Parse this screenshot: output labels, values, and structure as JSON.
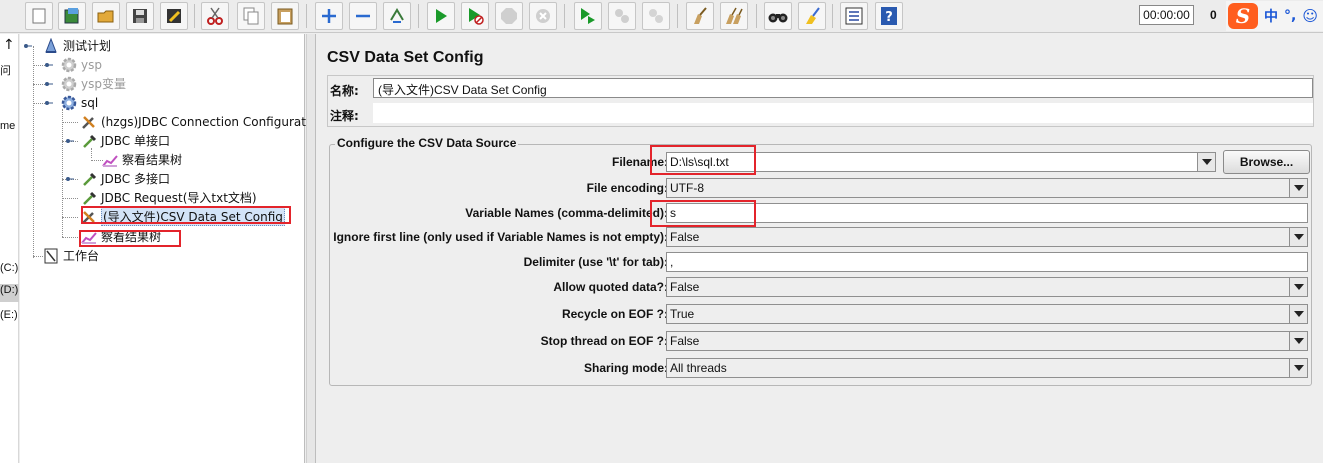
{
  "toolbar": {
    "buttons": [
      "new-icon",
      "templates-icon",
      "open-icon",
      "save-icon",
      "save-as-icon",
      "cut-icon",
      "copy-icon",
      "paste-icon",
      "expand-icon",
      "collapse-icon",
      "toggle-icon",
      "start-icon",
      "start-no-timers-icon",
      "stop-icon",
      "shutdown-icon",
      "remote-start-icon",
      "remote-stop-icon",
      "remote-shutdown-icon",
      "clear-icon",
      "clear-all-icon",
      "search-icon",
      "reset-search-icon",
      "function-helper-icon",
      "help-icon"
    ],
    "timer": "00:00:00",
    "active_threads": "0"
  },
  "ime": {
    "logo": "S",
    "lang": "中",
    "punct": "°,",
    "emoji": "☺"
  },
  "left_strip": [
    "问",
    "me",
    "(C:)",
    "(D:)",
    "(E:)"
  ],
  "tree": {
    "items": [
      {
        "label": "测试计划",
        "icon": "test-plan-icon"
      },
      {
        "label": "ysp",
        "icon": "thread-group-icon",
        "disabled": true
      },
      {
        "label": "ysp变量",
        "icon": "thread-group-icon",
        "disabled": true
      },
      {
        "label": "sql",
        "icon": "thread-group-icon"
      },
      {
        "label": "(hzgs)JDBC Connection Configuration",
        "icon": "config-icon"
      },
      {
        "label": "JDBC 单接口",
        "icon": "sampler-icon"
      },
      {
        "label": "察看结果树",
        "icon": "listener-icon"
      },
      {
        "label": "JDBC 多接口",
        "icon": "sampler-icon"
      },
      {
        "label": "JDBC Request(导入txt文档)",
        "icon": "sampler-icon"
      },
      {
        "label": "(导入文件)CSV Data Set Config",
        "icon": "config-icon",
        "selected": true
      },
      {
        "label": "察看结果树",
        "icon": "listener-icon"
      },
      {
        "label": "工作台",
        "icon": "workbench-icon"
      }
    ]
  },
  "panel": {
    "title": "CSV Data Set Config",
    "name_label": "名称:",
    "name_value": "(导入文件)CSV Data Set Config",
    "comment_label": "注释:",
    "comment_value": "",
    "group_title": "Configure the CSV Data Source",
    "fields": {
      "filename": {
        "label": "Filename:",
        "value": "D:\\ls\\sql.txt"
      },
      "browse": "Browse...",
      "encoding": {
        "label": "File encoding:",
        "value": "UTF-8"
      },
      "varnames": {
        "label": "Variable Names (comma-delimited):",
        "value": "s"
      },
      "ignore_first": {
        "label": "Ignore first line (only used if Variable Names is not empty):",
        "value": "False"
      },
      "delimiter": {
        "label": "Delimiter (use '\\t' for tab):",
        "value": ","
      },
      "quoted": {
        "label": "Allow quoted data?:",
        "value": "False"
      },
      "recycle": {
        "label": "Recycle on EOF ?:",
        "value": "True"
      },
      "stop_thread": {
        "label": "Stop thread on EOF ?:",
        "value": "False"
      },
      "sharing": {
        "label": "Sharing mode:",
        "value": "All threads"
      }
    }
  },
  "colors": {
    "highlight_box": "#e3242b",
    "selection": "#d3e3f7"
  }
}
